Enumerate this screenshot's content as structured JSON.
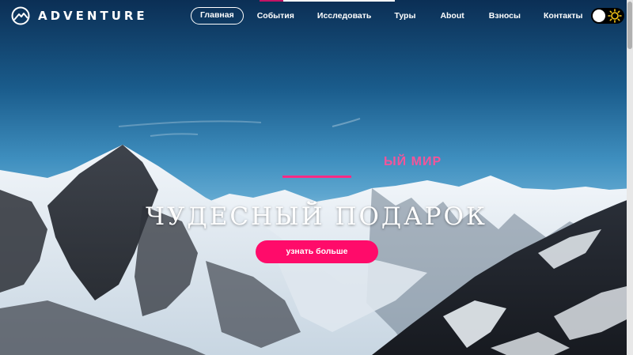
{
  "brand": {
    "name": "ADVENTURE",
    "icon": "mountain-logo-icon"
  },
  "nav": {
    "items": [
      {
        "label": "Главная",
        "active": true
      },
      {
        "label": "События",
        "active": false
      },
      {
        "label": "Исследовать",
        "active": false
      },
      {
        "label": "Туры",
        "active": false
      },
      {
        "label": "About",
        "active": false
      },
      {
        "label": "Взносы",
        "active": false
      },
      {
        "label": "Контакты",
        "active": false
      }
    ]
  },
  "theme_toggle": {
    "icon": "sun-icon",
    "state": "off"
  },
  "hero": {
    "subtitle": "ЫЙ МИР",
    "headline": "ЧУДЕСНЫЙ ПОДАРОК",
    "cta_label": "узнать больше"
  },
  "colors": {
    "accent": "#ff0b6a",
    "subtitle": "#f4559a",
    "nav_indicator": "#c31464"
  }
}
